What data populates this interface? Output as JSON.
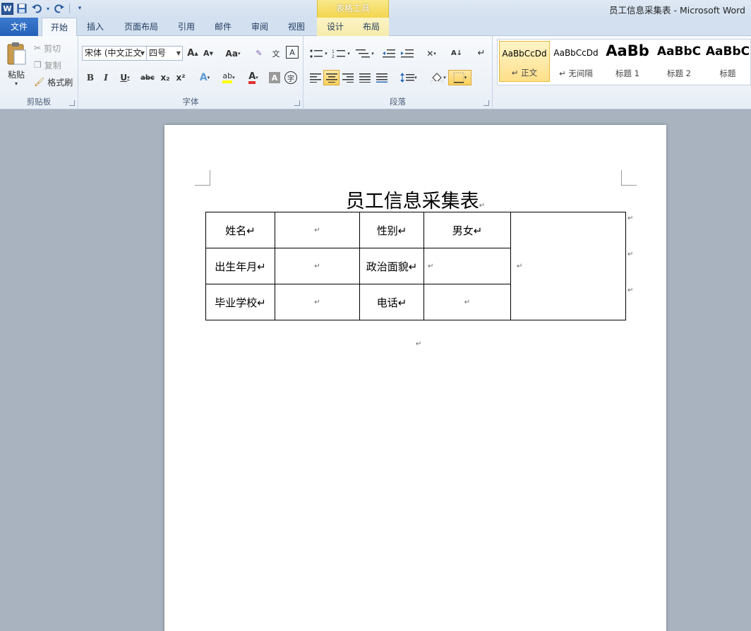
{
  "window": {
    "title": "员工信息采集表 - Microsoft Word",
    "context_tool_group": "表格工具"
  },
  "tabs": [
    "文件",
    "开始",
    "插入",
    "页面布局",
    "引用",
    "邮件",
    "审阅",
    "视图",
    "设计",
    "布局"
  ],
  "ribbon": {
    "clipboard": {
      "label": "剪贴板",
      "paste": "粘贴",
      "cut": "剪切",
      "copy": "复制",
      "format_painter": "格式刷"
    },
    "font": {
      "label": "字体",
      "font_name": "宋体 (中文正文",
      "font_size": "四号",
      "grow": "A",
      "shrink": "A",
      "change_case": "Aa",
      "bold": "B",
      "italic": "I",
      "underline": "U",
      "strikethrough": "abc",
      "subscript": "x₂",
      "superscript": "x²",
      "highlight": "ab",
      "font_color": "A",
      "char_shading": "A",
      "enclose": "字"
    },
    "paragraph": {
      "label": "段落"
    },
    "styles": {
      "items": [
        {
          "sample": "AaBbCcDd",
          "name": "↵ 正文"
        },
        {
          "sample": "AaBbCcDd",
          "name": "↵ 无间隔"
        },
        {
          "sample": "AaBb",
          "name": "标题 1"
        },
        {
          "sample": "AaBbC",
          "name": "标题 2"
        },
        {
          "sample": "AaBbC",
          "name": "标题"
        }
      ]
    }
  },
  "document": {
    "title": "员工信息采集表",
    "paragraph_mark": "↵",
    "table": {
      "rows": [
        [
          "姓名↵",
          "↵",
          "性别↵",
          "男女↵"
        ],
        [
          "出生年月↵",
          "↵",
          "政治面貌↵",
          "↵"
        ],
        [
          "毕业学校↵",
          "↵",
          "电话↵",
          "↵"
        ]
      ],
      "photo_cell": "↵"
    }
  },
  "colors": {
    "file_tab": "#2b64b8",
    "context_tab": "#f3d54e",
    "selected_style": "#ffe08a"
  }
}
